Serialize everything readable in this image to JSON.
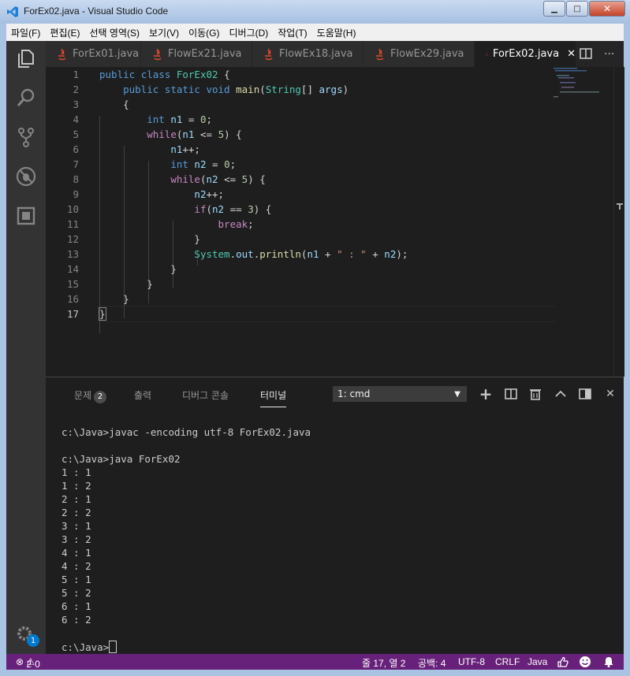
{
  "window": {
    "title": "ForEx02.java - Visual Studio Code",
    "minimize": "▁",
    "maximize": "□",
    "close": "✕"
  },
  "menu": [
    "파일(F)",
    "편집(E)",
    "선택 영역(S)",
    "보기(V)",
    "이동(G)",
    "디버그(D)",
    "작업(T)",
    "도움말(H)"
  ],
  "tabs": [
    {
      "label": "ForEx01.java"
    },
    {
      "label": "FlowEx21.java"
    },
    {
      "label": "FlowEx18.java"
    },
    {
      "label": "FlowEx29.java"
    },
    {
      "label": "ForEx02.java",
      "close": "✕"
    }
  ],
  "tab_actions": {
    "more": "···"
  },
  "line_numbers": [
    "1",
    "2",
    "3",
    "4",
    "5",
    "6",
    "7",
    "8",
    "9",
    "10",
    "11",
    "12",
    "13",
    "14",
    "15",
    "16",
    "17"
  ],
  "code": {
    "l1": [
      "public",
      " ",
      "class",
      " ",
      "ForEx02",
      " {"
    ],
    "l2": [
      "    ",
      "public",
      " ",
      "static",
      " ",
      "void",
      " ",
      "main",
      "(",
      "String",
      "[] ",
      "args",
      ")"
    ],
    "l3": "    {",
    "l4": [
      "        ",
      "int",
      " ",
      "n1",
      " = ",
      "0",
      ";"
    ],
    "l5": [
      "        ",
      "while",
      "(",
      "n1",
      " <= ",
      "5",
      ") {"
    ],
    "l6": [
      "            ",
      "n1",
      "++;"
    ],
    "l7": [
      "            ",
      "int",
      " ",
      "n2",
      " = ",
      "0",
      ";"
    ],
    "l8": [
      "            ",
      "while",
      "(",
      "n2",
      " <= ",
      "5",
      ") {"
    ],
    "l9": [
      "                ",
      "n2",
      "++;"
    ],
    "l10": [
      "                ",
      "if",
      "(",
      "n2",
      " == ",
      "3",
      ") {"
    ],
    "l11": [
      "                    ",
      "break",
      ";"
    ],
    "l12": "                }",
    "l13": [
      "                ",
      "System",
      ".",
      "out",
      ".",
      "println",
      "(",
      "n1",
      " + ",
      "\" : \"",
      " + ",
      "n2",
      ");"
    ],
    "l14": "            }",
    "l15": "        }",
    "l16": "    }",
    "l17": "}"
  },
  "panel": {
    "tabs": [
      "문제",
      "출력",
      "디버그 콘솔",
      "터미널"
    ],
    "problems_count": "2",
    "terminal_select": "1: cmd",
    "actions": {
      "add": "+",
      "split": "◫",
      "delete": "🗑",
      "maximize": "^",
      "layout": "◧",
      "close": "✕"
    },
    "terminal_lines": [
      "c:\\Java>javac -encoding utf-8 ForEx02.java",
      "",
      "c:\\Java>java ForEx02",
      "1 : 1",
      "1 : 2",
      "2 : 1",
      "2 : 2",
      "3 : 1",
      "3 : 2",
      "4 : 1",
      "4 : 2",
      "5 : 1",
      "5 : 2",
      "6 : 1",
      "6 : 2",
      ""
    ],
    "prompt": "c:\\Java>"
  },
  "activity": {
    "settings_badge": "1"
  },
  "status": {
    "errors": "2",
    "warnings": "0",
    "position": "줄 17, 열 2",
    "spaces": "공백: 4",
    "encoding": "UTF-8",
    "eol": "CRLF",
    "language": "Java"
  },
  "colors": {
    "status_bar": "#68217a",
    "activity_bar": "#333333",
    "editor_bg": "#1e1e1e",
    "accent": "#007acc"
  }
}
